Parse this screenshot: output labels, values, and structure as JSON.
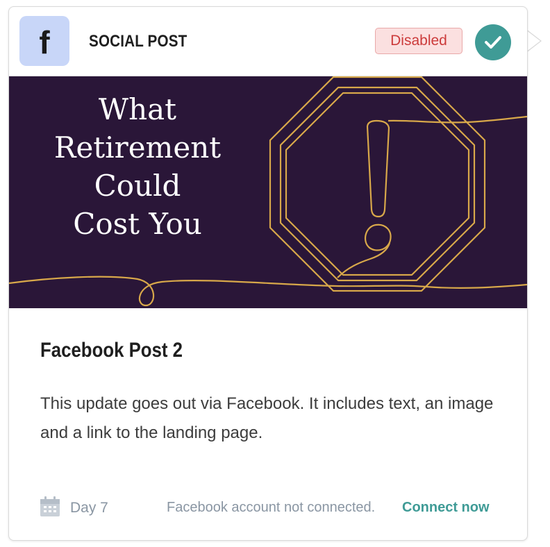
{
  "header": {
    "platform_icon_glyph": "f",
    "platform_icon": "facebook-icon",
    "type_label": "SOCIAL POST",
    "status": "Disabled",
    "status_color": "#cc3b3b",
    "check_icon": "check-icon",
    "check_color": "#3f9b96"
  },
  "hero": {
    "title": "What\nRetirement\nCould\nCost You",
    "background": "#2a1638",
    "line_color": "#d8a84a",
    "graphic": "warning-octagon-icon"
  },
  "post": {
    "title": "Facebook Post 2",
    "description": "This update goes out via Facebook. It includes text, an image and a link to the landing page."
  },
  "footer": {
    "day_icon": "calendar-icon",
    "day_label": "Day 7",
    "connection_text": "Facebook account not connected.",
    "connect_link": "Connect now",
    "link_color": "#3f9b96"
  }
}
